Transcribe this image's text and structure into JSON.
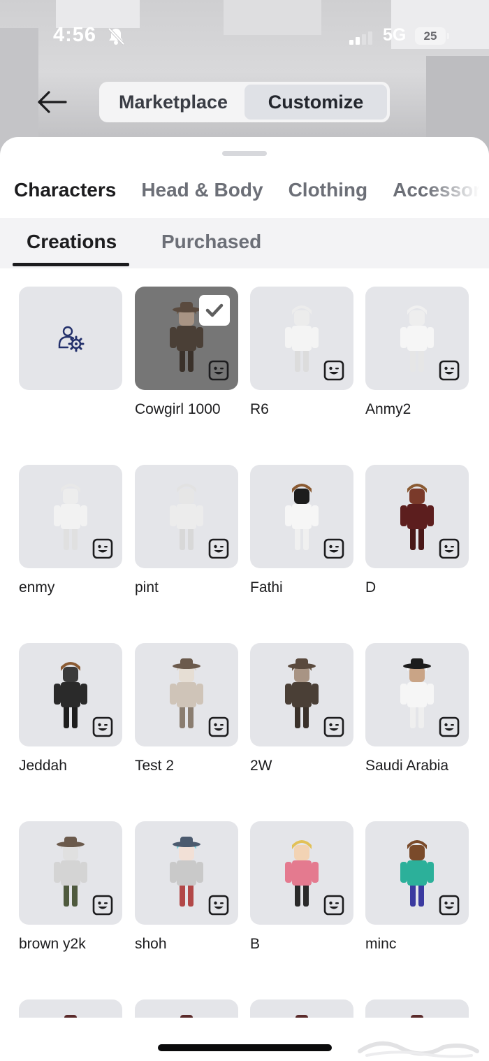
{
  "status": {
    "time": "4:56",
    "network": "5G",
    "battery": "25"
  },
  "header": {
    "segments": [
      {
        "label": "Marketplace",
        "active": false
      },
      {
        "label": "Customize",
        "active": true
      }
    ]
  },
  "category_tabs": [
    {
      "label": "Characters",
      "active": true
    },
    {
      "label": "Head & Body",
      "active": false
    },
    {
      "label": "Clothing",
      "active": false
    },
    {
      "label": "Accessories",
      "active": false
    }
  ],
  "sub_tabs": [
    {
      "label": "Creations",
      "active": true
    },
    {
      "label": "Purchased",
      "active": false
    }
  ],
  "characters": [
    {
      "name": "",
      "type": "create",
      "icon": "character-settings-icon"
    },
    {
      "name": "Cowgirl 1000",
      "selected": true,
      "outfit": "cowboy-hat-dark"
    },
    {
      "name": "R6",
      "outfit": "white-blocky"
    },
    {
      "name": "Anmy2",
      "outfit": "white-tall"
    },
    {
      "name": "enmy",
      "outfit": "white-small"
    },
    {
      "name": "pint",
      "outfit": "white-hood"
    },
    {
      "name": "Fathi",
      "outfit": "brown-hair-white"
    },
    {
      "name": "D",
      "outfit": "brown-hair-maroon"
    },
    {
      "name": "Jeddah",
      "outfit": "brown-hair-black"
    },
    {
      "name": "Test 2",
      "outfit": "cowboy-hat-light"
    },
    {
      "name": "2W",
      "outfit": "cowboy-hat-dark"
    },
    {
      "name": "Saudi Arabia",
      "outfit": "white-thobe"
    },
    {
      "name": "brown y2k",
      "outfit": "cowboy-hat-grey"
    },
    {
      "name": "shoh",
      "outfit": "teal-hair"
    },
    {
      "name": "B",
      "outfit": "blonde-pink"
    },
    {
      "name": "minc",
      "outfit": "classic-noob"
    },
    {
      "name": "",
      "outfit": "partial"
    },
    {
      "name": "",
      "outfit": "partial"
    },
    {
      "name": "",
      "outfit": "partial"
    },
    {
      "name": "",
      "outfit": "partial"
    }
  ],
  "colors": {
    "accent": "#1c1c1e",
    "tile": "#e4e5e9",
    "selected_tile": "#767676"
  }
}
